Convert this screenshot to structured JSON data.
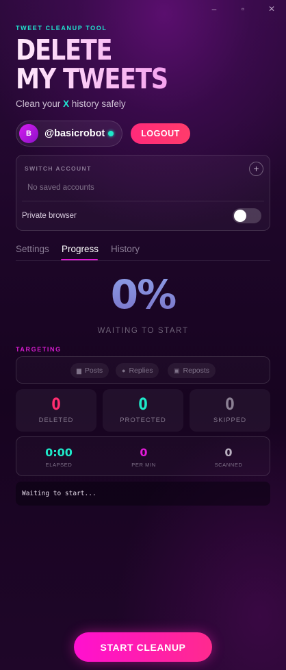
{
  "window": {
    "minimize": "–",
    "maximize": "▫",
    "close": "✕"
  },
  "header": {
    "eyebrow": "TWEET CLEANUP TOOL",
    "title_line1": "DELETE",
    "title_line2": "MY TWEETS",
    "tagline_pre": "Clean your",
    "tagline_x": "X",
    "tagline_post": "history safely"
  },
  "user": {
    "avatar_letter": "B",
    "handle": "@basicrobot",
    "online_color": "#1ee8c9"
  },
  "logout_label": "LOGOUT",
  "account": {
    "heading": "SWITCH ACCOUNT",
    "add_icon": "+",
    "empty_text": "No saved accounts",
    "private_label": "Private browser",
    "private_enabled": false
  },
  "tabs": [
    {
      "label": "Settings",
      "active": false
    },
    {
      "label": "Progress",
      "active": true
    },
    {
      "label": "History",
      "active": false
    }
  ],
  "progress": {
    "percent": "0%",
    "status": "WAITING TO START"
  },
  "targeting": {
    "label": "TARGETING",
    "options": [
      {
        "label": "Posts",
        "icon": "post-icon"
      },
      {
        "label": "Replies",
        "icon": "reply-icon"
      },
      {
        "label": "Reposts",
        "icon": "repost-icon"
      }
    ]
  },
  "stats": [
    {
      "value": "0",
      "label": "DELETED",
      "color": "#ff2d6f"
    },
    {
      "value": "0",
      "label": "PROTECTED",
      "color": "#1ee8c9"
    },
    {
      "value": "0",
      "label": "SKIPPED",
      "color": "#8b8093"
    }
  ],
  "metrics": [
    {
      "value": "0:00",
      "label": "ELAPSED",
      "color": "#1ee8c9"
    },
    {
      "value": "0",
      "label": "PER MIN",
      "color": "#e21ad8"
    },
    {
      "value": "0",
      "label": "SCANNED",
      "color": "#b9b0c0"
    }
  ],
  "console_text": "Waiting to start...",
  "start_label": "START CLEANUP"
}
